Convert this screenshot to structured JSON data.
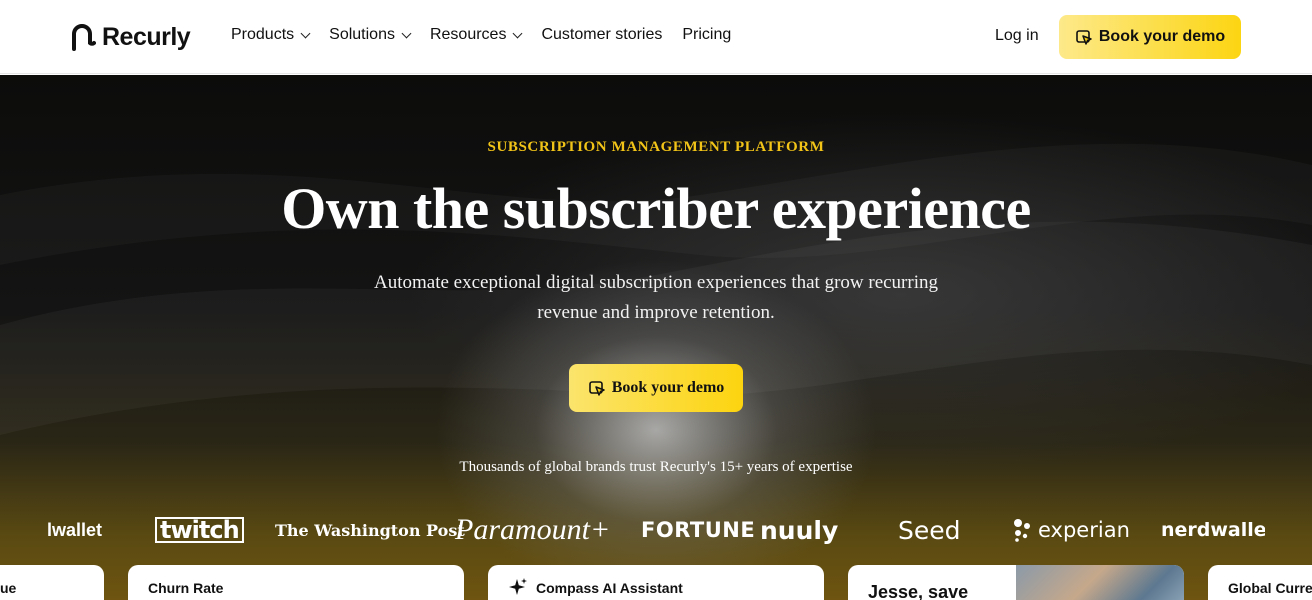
{
  "header": {
    "logo_text": "Recurly",
    "nav": [
      {
        "label": "Products",
        "has_dropdown": true
      },
      {
        "label": "Solutions",
        "has_dropdown": true
      },
      {
        "label": "Resources",
        "has_dropdown": true
      },
      {
        "label": "Customer stories",
        "has_dropdown": false
      },
      {
        "label": "Pricing",
        "has_dropdown": false
      }
    ],
    "login_label": "Log in",
    "demo_label": "Book your demo"
  },
  "hero": {
    "eyebrow": "SUBSCRIPTION MANAGEMENT PLATFORM",
    "headline": "Own the subscriber experience",
    "subtext": "Automate exceptional digital subscription experiences that grow recurring revenue and improve retention.",
    "cta_label": "Book your demo",
    "trust_line": "Thousands of global brands trust Recurly's 15+ years of expertise"
  },
  "brands": [
    "lwallet",
    "twitch",
    "The Washington Post",
    "Paramount+",
    "FORTUNE",
    "nuuly",
    "Seed",
    "experian",
    "nerdwalle"
  ],
  "cards": [
    {
      "title": "ue"
    },
    {
      "title": "Churn Rate"
    },
    {
      "title": "Compass AI Assistant",
      "icon": "sparkle-icon"
    },
    {
      "title": "Jesse, save"
    },
    {
      "title": "Global Curre"
    }
  ],
  "colors": {
    "accent_yellow": "#fcd512",
    "eyebrow_gold": "#f2c418",
    "hero_dark": "#0c0c0b"
  }
}
